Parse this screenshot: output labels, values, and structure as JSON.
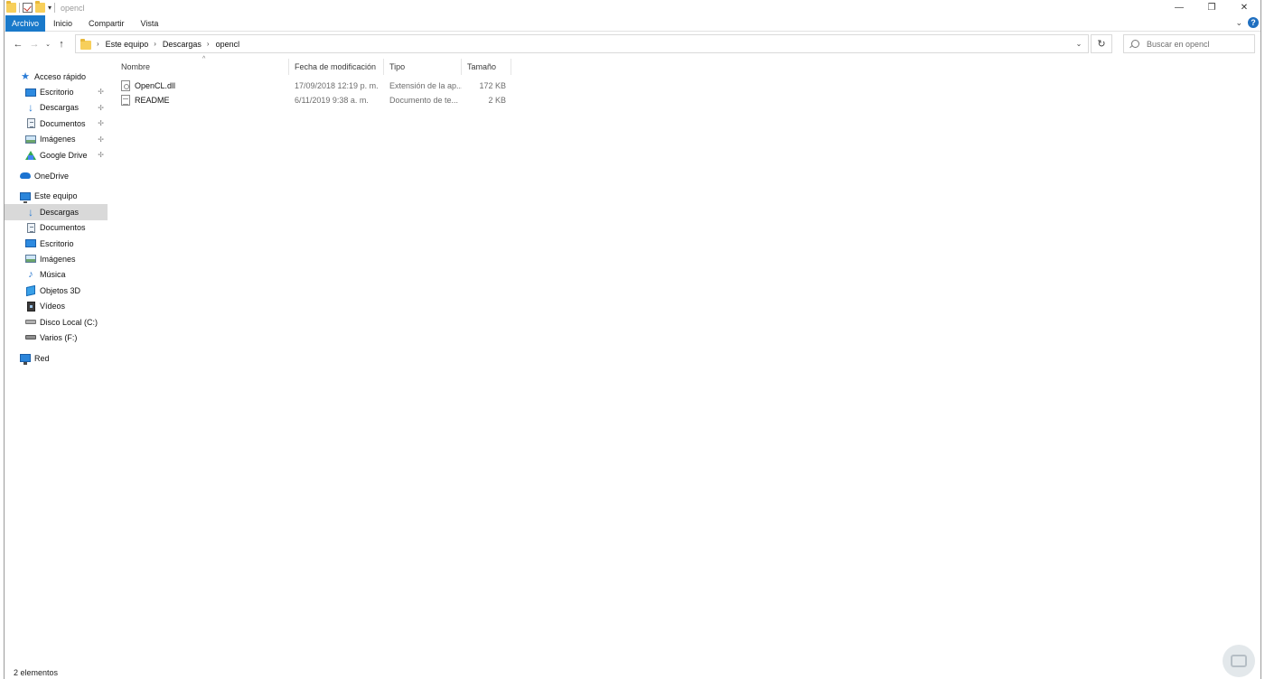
{
  "window": {
    "title": "opencl",
    "controls": {
      "minimize": "—",
      "maximize": "❐",
      "close": "✕"
    }
  },
  "ribbon": {
    "tabs": [
      "Archivo",
      "Inicio",
      "Compartir",
      "Vista"
    ],
    "help": "?"
  },
  "navigation": {
    "back": "←",
    "forward": "→",
    "recent": "⌄",
    "up": "↑",
    "breadcrumb": [
      "Este equipo",
      "Descargas",
      "opencl"
    ],
    "separator": "›",
    "refresh": "↻",
    "dropdown": "⌄"
  },
  "search": {
    "placeholder": "Buscar en opencl"
  },
  "sidebar": {
    "items": [
      {
        "label": "Acceso rápido",
        "icon": "star-icon"
      },
      {
        "label": "Escritorio",
        "icon": "desktop-icon",
        "pinned": true
      },
      {
        "label": "Descargas",
        "icon": "download-icon",
        "pinned": true
      },
      {
        "label": "Documentos",
        "icon": "documents-icon",
        "pinned": true
      },
      {
        "label": "Imágenes",
        "icon": "pictures-icon",
        "pinned": true
      },
      {
        "label": "Google Drive",
        "icon": "google-drive-icon",
        "pinned": true
      },
      {
        "label": "OneDrive",
        "icon": "cloud-icon"
      },
      {
        "label": "Este equipo",
        "icon": "computer-icon"
      },
      {
        "label": "Descargas",
        "icon": "download-icon",
        "selected": true
      },
      {
        "label": "Documentos",
        "icon": "documents-icon"
      },
      {
        "label": "Escritorio",
        "icon": "desktop-icon"
      },
      {
        "label": "Imágenes",
        "icon": "pictures-icon"
      },
      {
        "label": "Música",
        "icon": "music-icon"
      },
      {
        "label": "Objetos 3D",
        "icon": "3d-objects-icon"
      },
      {
        "label": "Vídeos",
        "icon": "videos-icon"
      },
      {
        "label": "Disco Local (C:)",
        "icon": "drive-icon"
      },
      {
        "label": "Varios (F:)",
        "icon": "drive-icon"
      },
      {
        "label": "Red",
        "icon": "network-icon"
      }
    ],
    "pin_glyph": "📌"
  },
  "filelist": {
    "columns": [
      "Nombre",
      "Fecha de modificación",
      "Tipo",
      "Tamaño"
    ],
    "sort_glyph": "^",
    "rows": [
      {
        "name": "OpenCL.dll",
        "date": "17/09/2018 12:19 p. m.",
        "type": "Extensión de la ap...",
        "size": "172 KB"
      },
      {
        "name": "README",
        "date": "6/11/2019 9:38 a. m.",
        "type": "Documento de te...",
        "size": "2 KB"
      }
    ]
  },
  "status": {
    "count": "2 elementos"
  },
  "colors": {
    "accent": "#1979ca",
    "selection": "#d9d9d9"
  }
}
